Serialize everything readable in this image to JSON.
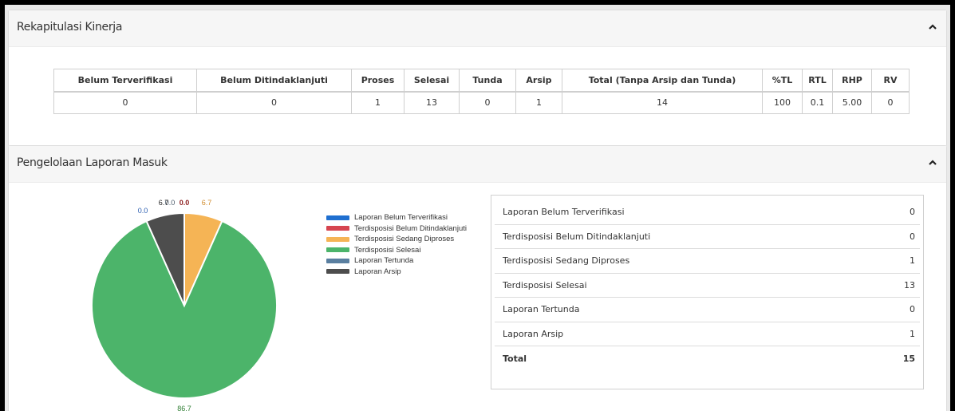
{
  "rekap": {
    "title": "Rekapitulasi Kinerja",
    "headers": [
      "Belum Terverifikasi",
      "Belum Ditindaklanjuti",
      "Proses",
      "Selesai",
      "Tunda",
      "Arsip",
      "Total (Tanpa Arsip dan Tunda)",
      "%TL",
      "RTL",
      "RHP",
      "RV"
    ],
    "values": [
      "0",
      "0",
      "1",
      "13",
      "0",
      "1",
      "14",
      "100",
      "0.1",
      "5.00",
      "0"
    ]
  },
  "pengelolaan": {
    "title": "Pengelolaan Laporan Masuk",
    "summary": [
      {
        "label": "Laporan Belum Terverifikasi",
        "value": "0"
      },
      {
        "label": "Terdisposisi Belum Ditindaklanjuti",
        "value": "0"
      },
      {
        "label": "Terdisposisi Sedang Diproses",
        "value": "1"
      },
      {
        "label": "Terdisposisi Selesai",
        "value": "13"
      },
      {
        "label": "Laporan Tertunda",
        "value": "0"
      },
      {
        "label": "Laporan Arsip",
        "value": "1"
      }
    ],
    "total": {
      "label": "Total",
      "value": "15"
    }
  },
  "chart_data": {
    "type": "pie",
    "labels": [
      "Laporan Belum Terverifikasi",
      "Terdisposisi Belum Ditindaklanjuti",
      "Terdisposisi Sedang Diproses",
      "Terdisposisi Selesai",
      "Laporan Tertunda",
      "Laporan Arsip"
    ],
    "values": [
      0.0,
      0.0,
      6.7,
      86.7,
      0.0,
      6.7
    ],
    "data_labels": [
      "0.0",
      "0.0",
      "6.7",
      "86.7",
      "0.0",
      "6.7"
    ],
    "colors": [
      "#1f6fd0",
      "#d64550",
      "#f5b455",
      "#4cb46a",
      "#5a7fa0",
      "#4d4d4d"
    ],
    "label_colors": [
      "#2a5db0",
      "#8b1a1a",
      "#d08a2a",
      "#2e7d32",
      "#4a5a6a",
      "#222222"
    ],
    "legend_position": "right"
  },
  "icons": {
    "collapse": "chevron-up-icon"
  }
}
